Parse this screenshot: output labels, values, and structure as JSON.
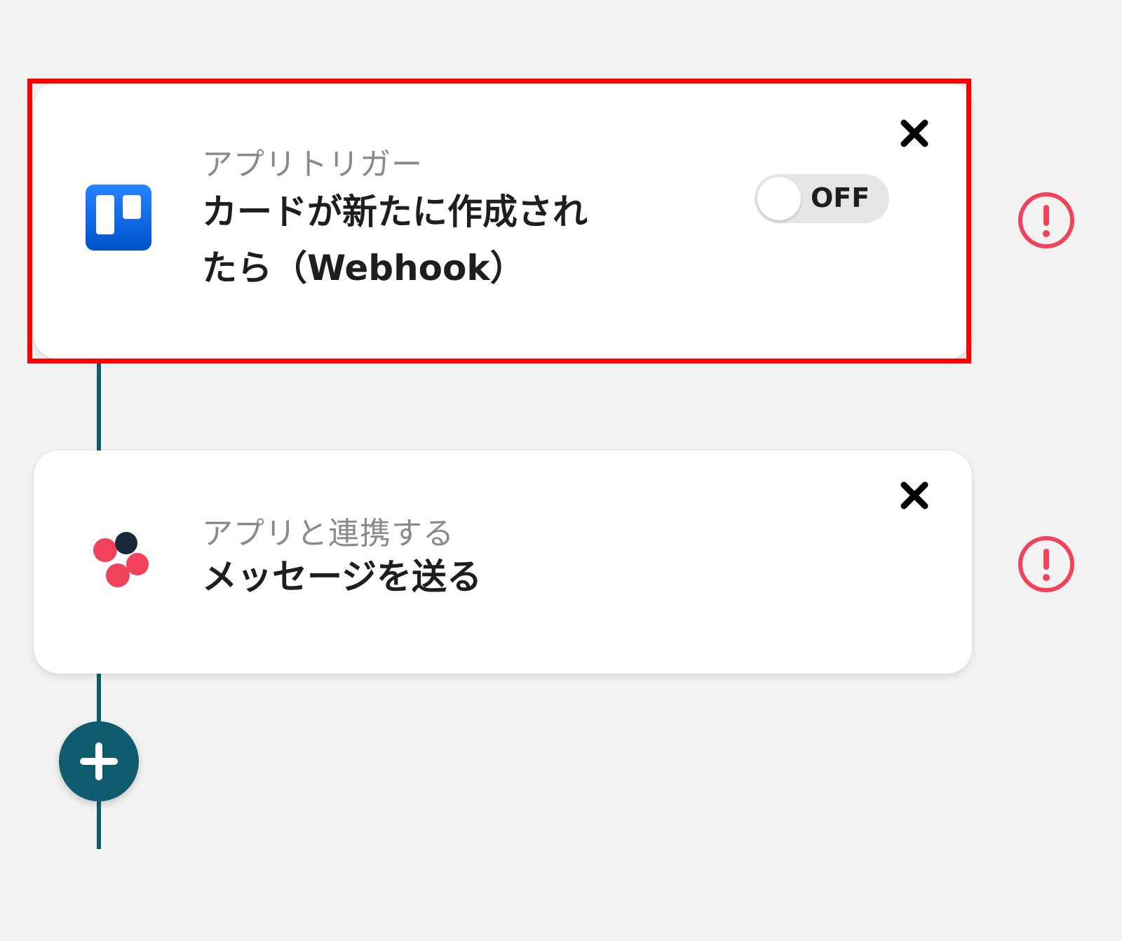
{
  "steps": [
    {
      "app_icon": "trello-icon",
      "subtitle": "アプリトリガー",
      "title": "カードが新たに作成されたら（Webhook）",
      "toggle_label": "OFF",
      "toggle_state": "off",
      "highlighted": true,
      "status": "error"
    },
    {
      "app_icon": "chatwork-icon",
      "subtitle": "アプリと連携する",
      "title": "メッセージを送る",
      "status": "error"
    }
  ],
  "colors": {
    "connector": "#0f5c6e",
    "alert": "#f0425a",
    "highlight": "#ff0000",
    "trello_blue": "#0c66e4"
  },
  "icons": {
    "close": "close-icon",
    "alert": "alert-circle-icon",
    "add": "plus-icon"
  }
}
